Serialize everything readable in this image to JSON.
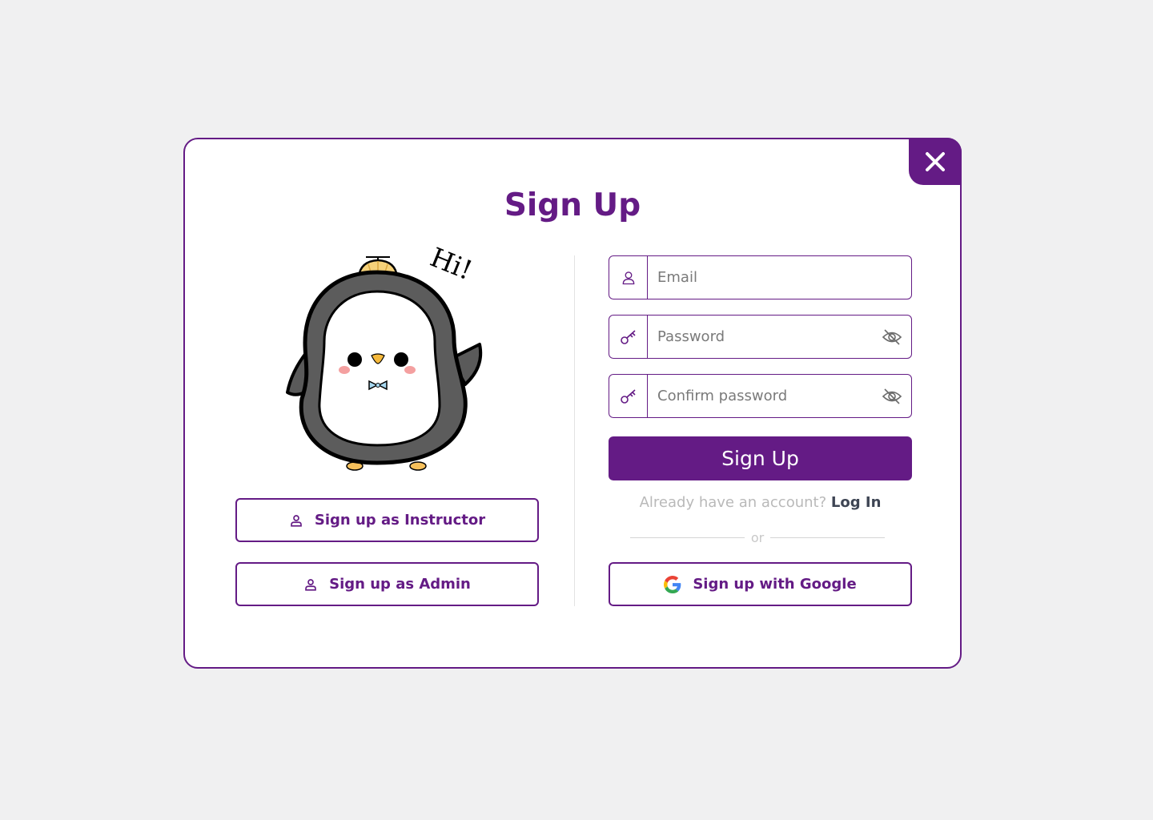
{
  "colors": {
    "brand": "#641b85",
    "background": "#f0f0f1",
    "muted_text": "#b9b9b9",
    "link_text": "#3e4554"
  },
  "modal": {
    "title": "Sign Up",
    "close_icon": "close-icon"
  },
  "mascot": {
    "speech": "Hi!"
  },
  "roles": {
    "instructor_label": "Sign up as Instructor",
    "admin_label": "Sign up as Admin",
    "icon": "user-icon"
  },
  "form": {
    "email": {
      "placeholder": "Email",
      "value": "",
      "icon": "user-icon"
    },
    "password": {
      "placeholder": "Password",
      "value": "",
      "icon": "key-icon",
      "toggle_icon": "eye-off-icon"
    },
    "confirm_password": {
      "placeholder": "Confirm password",
      "value": "",
      "icon": "key-icon",
      "toggle_icon": "eye-off-icon"
    },
    "submit_label": "Sign Up"
  },
  "login": {
    "prompt": "Already have an account?",
    "link_label": "Log In"
  },
  "divider": {
    "label": "or"
  },
  "google": {
    "label": "Sign up with Google",
    "icon": "google-icon"
  }
}
